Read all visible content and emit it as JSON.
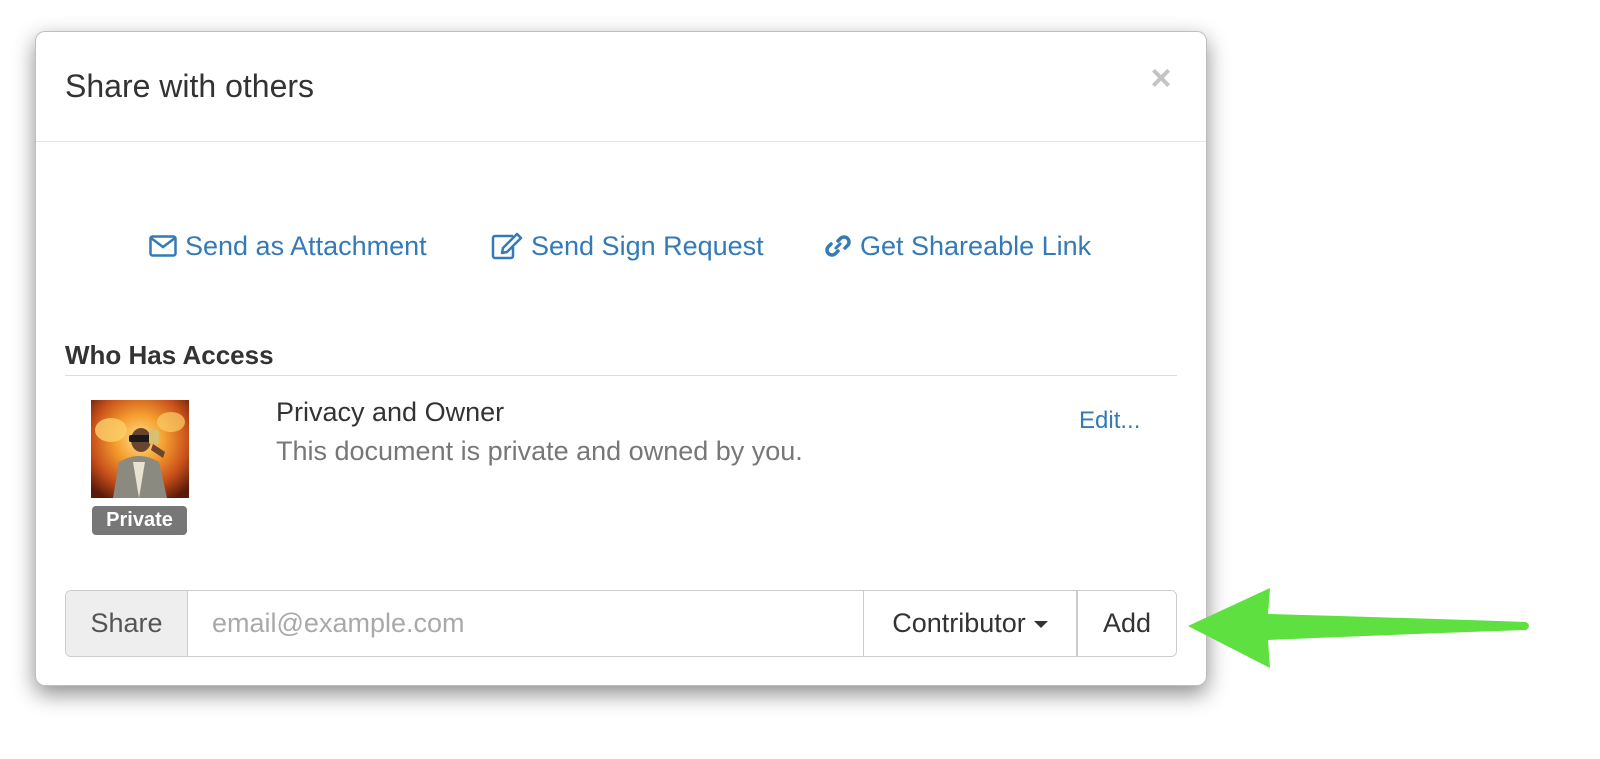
{
  "modal": {
    "title": "Share with others",
    "close_label": "×"
  },
  "actions": {
    "attachment": {
      "label": "Send as Attachment",
      "icon": "envelope-icon"
    },
    "sign_request": {
      "label": "Send Sign Request",
      "icon": "edit-icon"
    },
    "shareable_link": {
      "label": "Get Shareable Link",
      "icon": "link-icon"
    }
  },
  "access": {
    "heading": "Who Has Access",
    "badge": "Private",
    "title": "Privacy and Owner",
    "description": "This document is private and owned by you.",
    "edit_label": "Edit..."
  },
  "share": {
    "addon_label": "Share",
    "placeholder": "email@example.com",
    "role": "Contributor",
    "add_label": "Add"
  },
  "colors": {
    "link": "#337ab7",
    "badge": "#777777",
    "arrow": "#5ee040"
  }
}
